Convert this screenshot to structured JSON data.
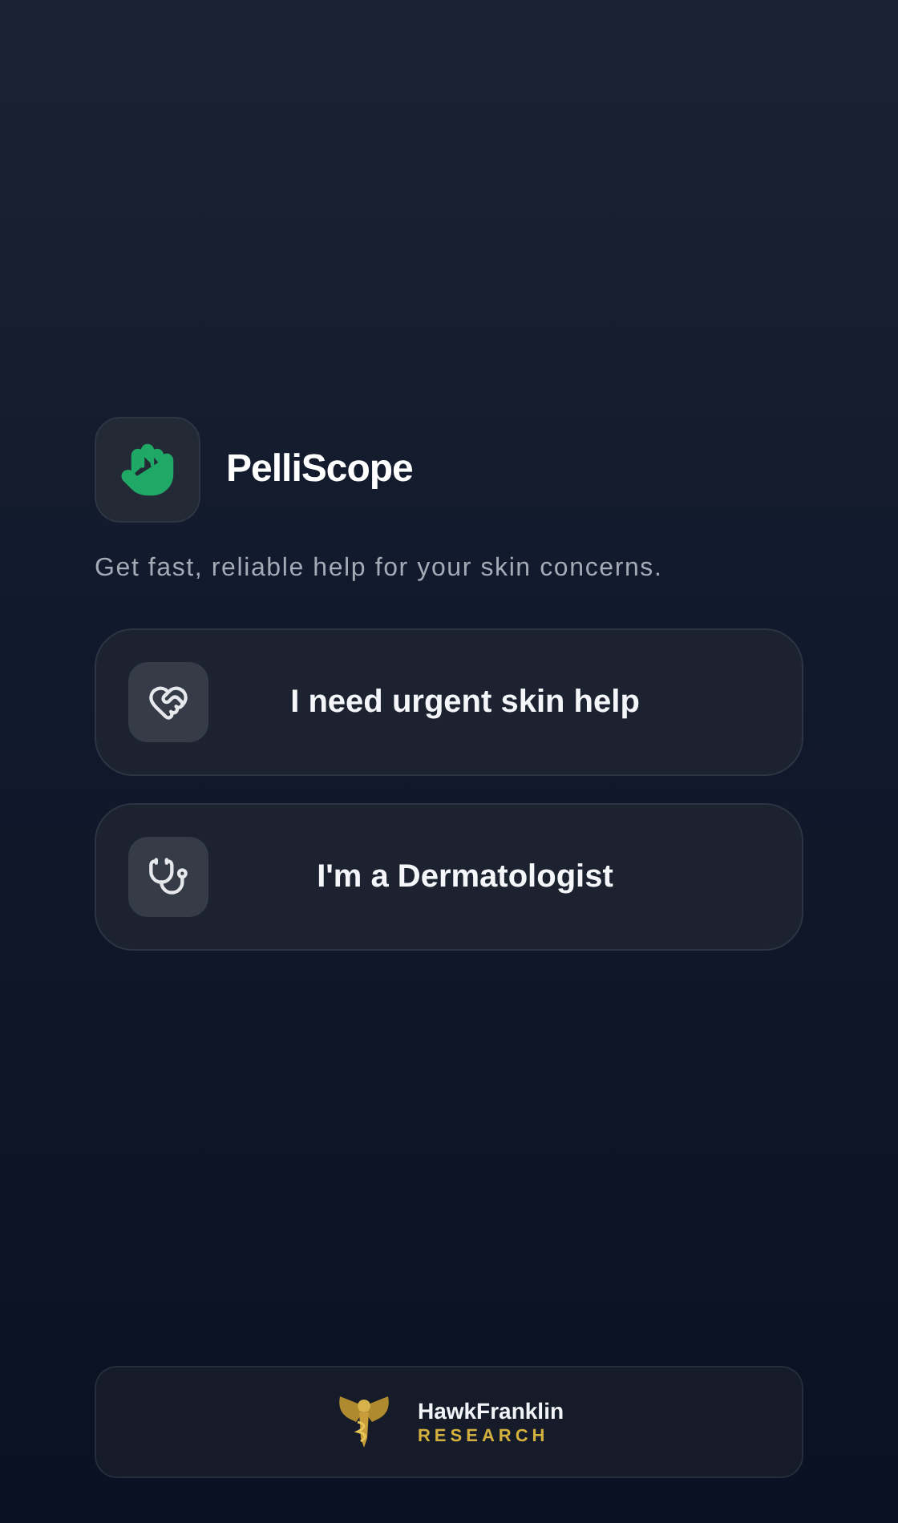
{
  "app": {
    "name": "PelliScope",
    "tagline": "Get fast, reliable help for your skin concerns."
  },
  "options": [
    {
      "kind": "patient",
      "label": "I need urgent skin help"
    },
    {
      "kind": "doctor",
      "label": "I'm a Dermatologist"
    }
  ],
  "footer": {
    "brand": "HawkFranklin",
    "subtitle": "RESEARCH"
  }
}
